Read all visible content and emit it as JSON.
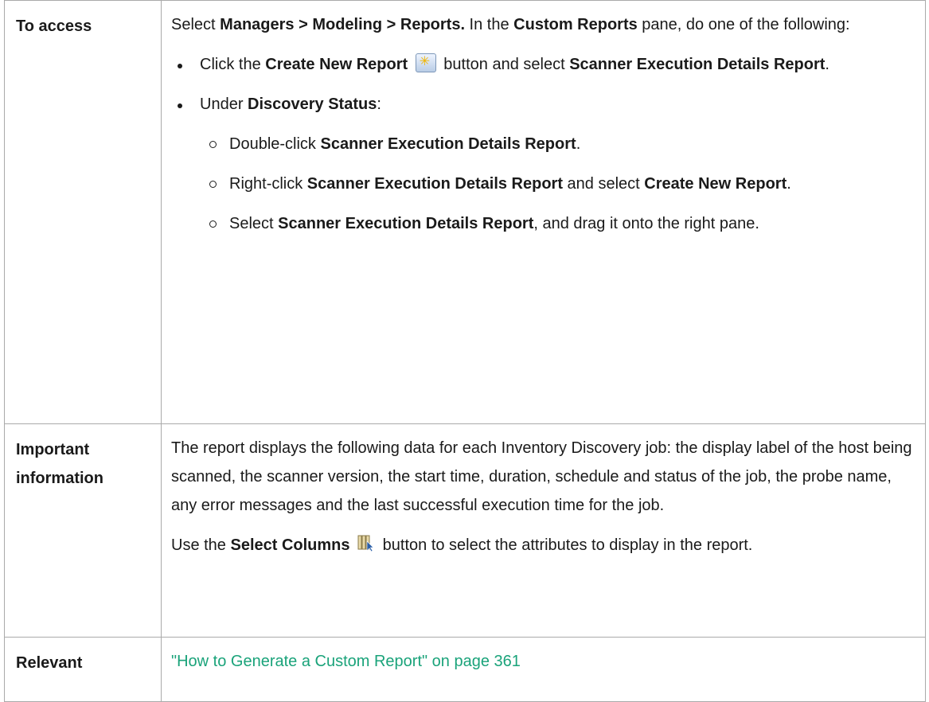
{
  "rows": {
    "access": {
      "header": "To access",
      "intro": {
        "p1": "Select ",
        "b1": "Managers > Modeling > Reports.",
        "p2": " In the ",
        "b2": "Custom Reports",
        "p3": " pane, do one of the following:"
      },
      "bullet1": {
        "p1": "Click the ",
        "b1": "Create New Report",
        "icon": "create-new-report-icon",
        "p2": " button and select ",
        "b2": "Scanner Execution Details Report",
        "p3": "."
      },
      "bullet2": {
        "p1": "Under ",
        "b1": "Discovery Status",
        "p2": ":"
      },
      "sub1": {
        "p1": "Double-click ",
        "b1": "Scanner Execution Details Report",
        "p2": "."
      },
      "sub2": {
        "p1": "Right-click ",
        "b1": "Scanner Execution Details Report",
        "p2": " and select ",
        "b2": "Create New Report",
        "p3": "."
      },
      "sub3": {
        "p1": "Select ",
        "b1": "Scanner Execution Details Report",
        "p2": ", and drag it onto the right pane."
      }
    },
    "important": {
      "header_line1": "Important",
      "header_line2": "information",
      "paragraph": "The report displays the following data for each Inventory Discovery job: the display label of the host being scanned, the scanner version, the start time, duration, schedule and status of the job, the probe name, any error messages and the last successful execution time for the job.",
      "columns": {
        "p1": "Use the ",
        "b1": "Select Columns",
        "icon": "select-columns-icon",
        "p2": " button to select the attributes to display in the report."
      }
    },
    "relevant": {
      "header": "Relevant",
      "link_text": "\"How to Generate a Custom Report\" on page 361"
    }
  },
  "colors": {
    "link": "#1aa37a",
    "border": "#aaaaaa",
    "text": "#1a1a1a"
  }
}
